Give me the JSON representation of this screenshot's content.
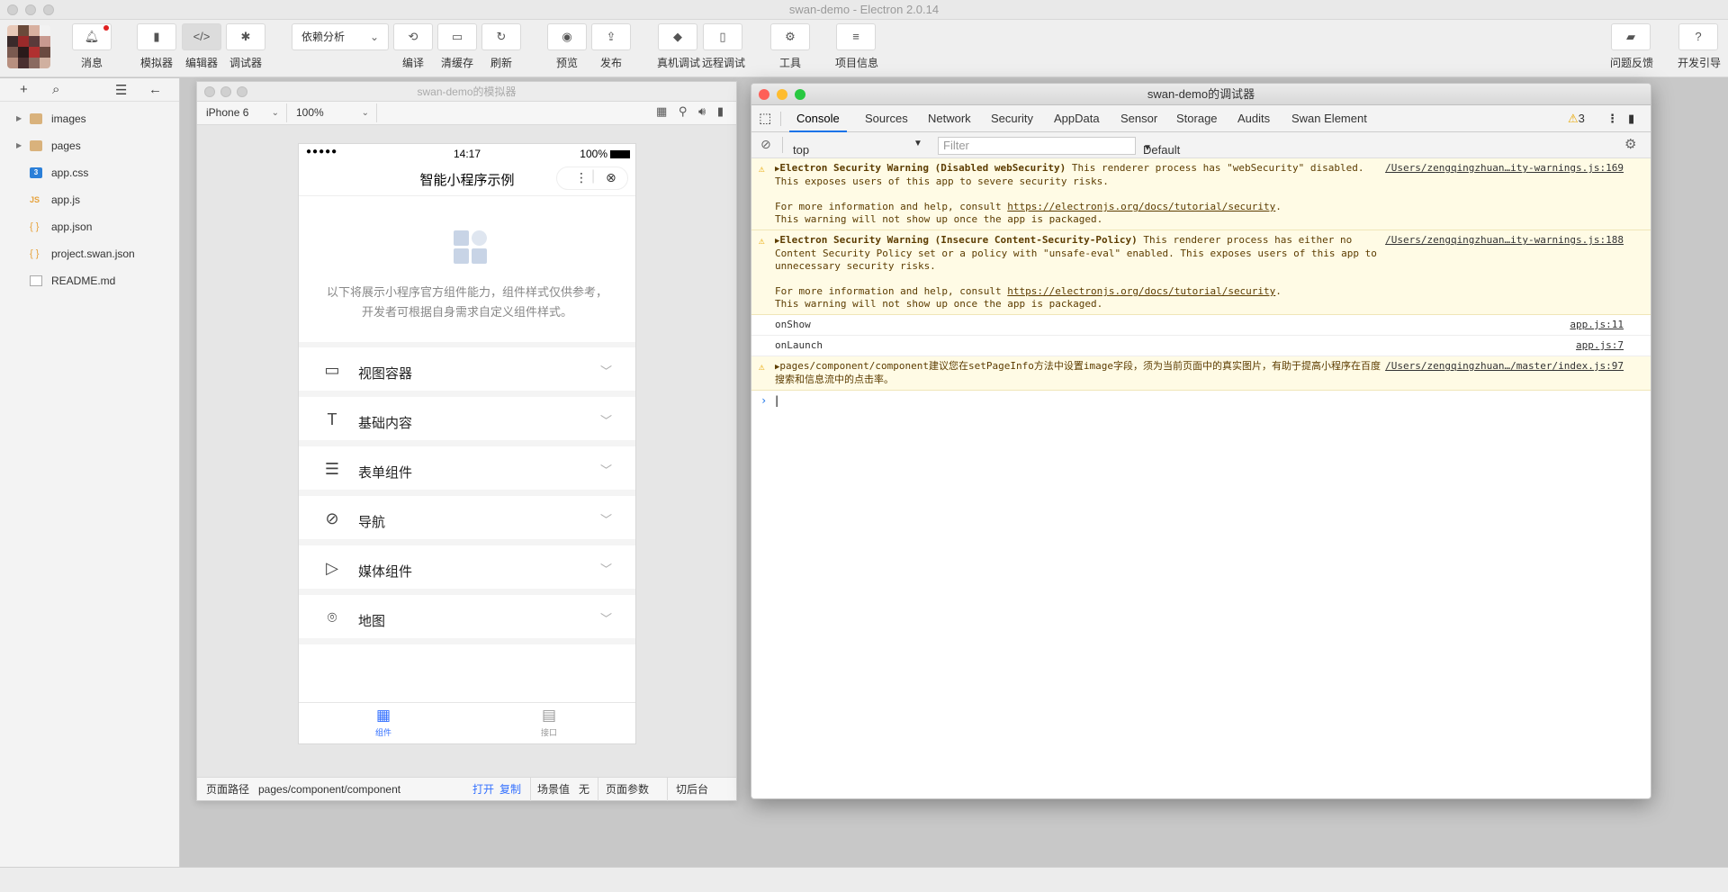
{
  "window": {
    "title": "swan-demo - Electron 2.0.14"
  },
  "toolbar": {
    "messages": "消息",
    "simulator": "模拟器",
    "editor": "编辑器",
    "debugger": "调试器",
    "dependency_select": "依赖分析",
    "compile": "编译",
    "clear_cache": "清缓存",
    "refresh": "刷新",
    "preview": "预览",
    "publish": "发布",
    "device_debug": "真机调试",
    "remote_debug": "远程调试",
    "tools": "工具",
    "project_info": "项目信息",
    "feedback": "问题反馈",
    "dev_guide": "开发引导"
  },
  "filetree": {
    "items": [
      {
        "label": "images",
        "type": "folder"
      },
      {
        "label": "pages",
        "type": "folder"
      },
      {
        "label": "app.css",
        "type": "css"
      },
      {
        "label": "app.js",
        "type": "js"
      },
      {
        "label": "app.json",
        "type": "json"
      },
      {
        "label": "project.swan.json",
        "type": "json"
      },
      {
        "label": "README.md",
        "type": "md"
      }
    ]
  },
  "simulator": {
    "title": "swan-demo的模拟器",
    "device": "iPhone 6",
    "zoom": "100%",
    "status_bar": {
      "signal": "●●●●●",
      "time": "14:17",
      "battery": "100%"
    },
    "nav_title": "智能小程序示例",
    "intro_line1": "以下将展示小程序官方组件能力，组件样式仅供参考，",
    "intro_line2": "开发者可根据自身需求自定义组件样式。",
    "components": [
      {
        "label": "视图容器",
        "icon": "view-container-icon"
      },
      {
        "label": "基础内容",
        "icon": "text-icon"
      },
      {
        "label": "表单组件",
        "icon": "list-icon"
      },
      {
        "label": "导航",
        "icon": "compass-icon"
      },
      {
        "label": "媒体组件",
        "icon": "play-icon"
      },
      {
        "label": "地图",
        "icon": "map-pin-icon"
      }
    ],
    "tabs": {
      "components": "组件",
      "api": "接口"
    },
    "bottom": {
      "path_label": "页面路径",
      "path": "pages/component/component",
      "open": "打开",
      "copy": "复制",
      "scene_label": "场景值",
      "scene_value": "无",
      "page_params": "页面参数",
      "switch_bg": "切后台"
    }
  },
  "debugger": {
    "title": "swan-demo的调试器",
    "tabs": [
      "Console",
      "Sources",
      "Network",
      "Security",
      "AppData",
      "Sensor",
      "Storage",
      "Audits",
      "Swan Element"
    ],
    "warning_count": "3",
    "context": "top",
    "filter_placeholder": "Filter",
    "levels": "Default levels",
    "messages": [
      {
        "bold": "Electron Security Warning (Disabled webSecurity)",
        "text": " This renderer process has \"webSecurity\" disabled. This exposes users of this app to severe security risks.",
        "more_prefix": "For more information and help, consult ",
        "link": "https://electronjs.org/docs/tutorial/security",
        "more_suffix": ".",
        "packaged": "This warning will not show up once the app is packaged.",
        "source": "/Users/zengqingzhuan…ity-warnings.js:169"
      },
      {
        "bold": "Electron Security Warning (Insecure Content-Security-Policy)",
        "text": " This renderer process has either no Content Security Policy set or a policy with \"unsafe-eval\" enabled. This exposes users of this app to unnecessary security risks.",
        "more_prefix": "For more information and help, consult ",
        "link": "https://electronjs.org/docs/tutorial/security",
        "more_suffix": ".",
        "packaged": "This warning will not show up once the app is packaged.",
        "source": "/Users/zengqingzhuan…ity-warnings.js:188"
      }
    ],
    "log1": {
      "text": "onShow",
      "source": "app.js:11"
    },
    "log2": {
      "text": "onLaunch",
      "source": "app.js:7"
    },
    "warn3": {
      "text": "pages/component/component建议您在setPageInfo方法中设置image字段，须为当前页面中的真实图片，有助于提高小程序在百度搜索和信息流中的点击率。",
      "source": "/Users/zengqingzhuan…/master/index.js:97"
    }
  },
  "colors": {
    "accent": "#1a73e8",
    "warning_bg": "#fffbe5",
    "tab_active": "#3370ff"
  }
}
